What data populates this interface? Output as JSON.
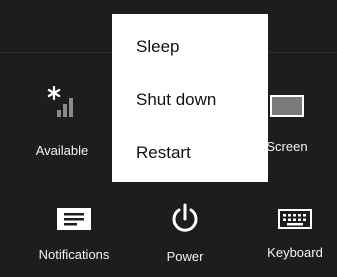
{
  "tiles": {
    "available": {
      "label": "Available",
      "icon": "network-signal-icon"
    },
    "screen": {
      "label": "Screen",
      "icon": "screen-brightness-icon"
    },
    "notifications": {
      "label": "Notifications",
      "icon": "notifications-icon"
    },
    "power": {
      "label": "Power",
      "icon": "power-icon"
    },
    "keyboard": {
      "label": "Keyboard",
      "icon": "keyboard-icon"
    }
  },
  "power_menu": {
    "items": [
      {
        "label": "Sleep"
      },
      {
        "label": "Shut down"
      },
      {
        "label": "Restart"
      }
    ]
  },
  "colors": {
    "background": "#1d1d1d",
    "menu_background": "#ffffff",
    "menu_text": "#111111",
    "tile_text": "#f2f2f2"
  }
}
